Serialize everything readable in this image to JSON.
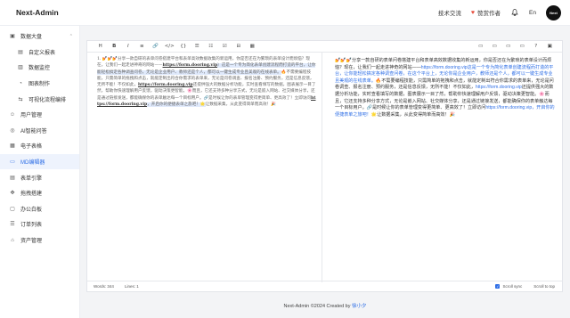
{
  "app": {
    "title": "Next-Admin"
  },
  "topbar": {
    "tech": "技术交流",
    "sponsor": "赞赏作者",
    "lang": "En",
    "avatar": "Next"
  },
  "sidebar": {
    "items": [
      {
        "label": "数据大盘",
        "icon": "dashboard-icon",
        "expanded": true
      },
      {
        "label": "自定义报表",
        "icon": "report-icon",
        "sub": true
      },
      {
        "label": "数据监控",
        "icon": "monitor-icon",
        "sub": true
      },
      {
        "label": "图表制作",
        "icon": "chart-icon",
        "sub": true
      },
      {
        "label": "可视化流程编排",
        "icon": "flow-icon",
        "sub": true
      },
      {
        "label": "用户管理",
        "icon": "user-icon"
      },
      {
        "label": "AI智能问答",
        "icon": "ai-icon"
      },
      {
        "label": "电子表格",
        "icon": "sheet-icon"
      },
      {
        "label": "MD编辑器",
        "icon": "markdown-icon",
        "active": true
      },
      {
        "label": "表单引擎",
        "icon": "form-icon"
      },
      {
        "label": "拖拽搭建",
        "icon": "drag-icon"
      },
      {
        "label": "办公白板",
        "icon": "whiteboard-icon"
      },
      {
        "label": "订单列表",
        "icon": "order-icon"
      },
      {
        "label": "资产管理",
        "icon": "asset-icon"
      }
    ]
  },
  "editor": {
    "toolbar_left": [
      "H",
      "B",
      "I",
      "≡",
      "🔗",
      "</>",
      "{}",
      "☰",
      "☷",
      "☑",
      "⊟",
      "▦"
    ],
    "toolbar_right": [
      "▭",
      "▭",
      "▭",
      "▭",
      "?",
      "▣"
    ],
    "source": {
      "p1": "1. 💅💅💅分享一款自研的表单问卷搭建平台和表单高效数据收集的新运用，你是否还在为繁琐的表单设计而烦恼？现在，让我们一起走进神奇的网站——",
      "link1": "https://form.dooring.vip",
      "p2": "）这是一个专为简化表单创建流程而打造的平台，让你能轻松搞定各种调查问卷，",
      "p3": "无论是企业用户、教师还是个人，都可以一键生成专业且美观的在线表单。",
      "p4": "🔥不需要编程技能，只需简单的拖拽和点击，就能定制出符合你需求的表单来，无论是问卷调查、报名注册、预约服务，还是信息反馈，无所不能！不仅如此，",
      "link2": "https://form.dooring.vip",
      "p5": "还提供强大的数据分析功能，实时查看填写的数据，图表展示一目了然，帮助你快速理解用户反馈，驱动决策更智能。🌸而且，它还支持多种分享方式，无论是嵌入网站、社交媒体分享，还是通过链接发送，都能确保你的表单触达每一个目标用户。🔗是时候让你的表单管理变得更简单、更高效了！立即访问",
      "link3": "https://form.dooring.vip",
      "p6": "，开启你的便捷表单之旅吧！🌟",
      "p7": "让数据采集，从此变得简单而高效！🎉"
    },
    "preview": {
      "p1": "💅💅💅分享一款自研的表单问卷搭建平台和表单高效数据收集的新运用，你是否还在为繁琐的表单设计而烦恼？现在，让我们一起走进神奇的网站——",
      "link1": "https://form.dooring.vip",
      "p2": "这是一个专为简化表单创建流程而打造的平台，让你能轻松搞定各种调查问卷，在这个平台上，无论你是企业用户，教师还是个人，都可以一键生成专业且美观的在线表单。",
      "p3": "🔥不需要编程技能，只需简单的拖拽和点击，就能定制出符合你需求的表单来，无论是问卷调查、报名注册、预约服务，还是信息反馈，无所不能！不仅如此，",
      "link2": "https://form.dooring.vip",
      "p4": "还提供强大的数据分析功能，实时查看填写的数据，图表展示一目了然，帮助你快速理解用户反馈，驱动决策更智能。🌸而且，它还支持多种分享方式，无论是嵌入网站、社交媒体分享，还是通过链接发送，都能确保你的表单触达每一个目标用户。🔗是时候让你的表单管理变得更简单、更高效了！立即访问",
      "link3": "https://form.dooring.vip",
      "p5": "，开启你的便捷表单之旅吧！",
      "p6": "🌟让数据采集，从此变得简单而高效！🎉"
    },
    "status": {
      "words": "Words: 344",
      "lines": "Lines: 1",
      "sync": "Scroll sync",
      "top": "Scroll to top"
    }
  },
  "footer": {
    "text": "Next-Admin ©2024 Created by",
    "author": "徐小夕"
  },
  "colors": {
    "accent": "#2f6fe6",
    "heart": "#e74c3c"
  }
}
